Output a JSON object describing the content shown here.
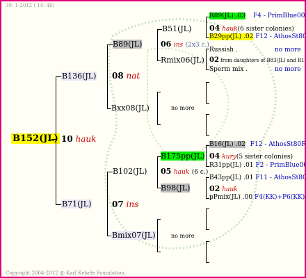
{
  "header_text": "30-  1-2012 ( 14: 46)",
  "footer_text": "Copyright 2004-2012 @ Karl Kehele Foundation.",
  "root": {
    "name": "B152(JL)",
    "num": "10",
    "note": "hauk"
  },
  "gen1": [
    {
      "name": "B136(JL)",
      "num": "08",
      "note": "nat"
    },
    {
      "name": "B71(JL)",
      "num": "07",
      "note": "ins"
    }
  ],
  "gen2": [
    {
      "name": "B89(JL)",
      "num": "06",
      "note": "ins",
      "extra": "(2x3 c.)"
    },
    {
      "name": "Bxx08(JL)"
    },
    {
      "name": "B102(JL)",
      "num": "05",
      "note": "hauk",
      "extra": "(6 c.)"
    },
    {
      "name": "Bmix07(JL)"
    }
  ],
  "gen3": [
    {
      "name": "B51(JL)",
      "num": "04",
      "note": "ins",
      "extra": "(2x3 c.)"
    },
    {
      "name": "Rmix06(JL)"
    },
    {
      "name": "no more"
    },
    {
      "name": "B175pp(JL)",
      "num": "04",
      "note": "kury",
      "extra": "(5 sister colonies)"
    },
    {
      "name": "B98(JL)",
      "num": "02",
      "note": "hauk"
    },
    {
      "name": "no more"
    }
  ],
  "gen4": [
    {
      "name": "R89(JL) .03",
      "info": "F4 - PrimBlue00"
    },
    {
      "num": "04",
      "note": "hauk",
      "extra": "(6 sister colonies)"
    },
    {
      "name": "B29pp(JL) .02",
      "info": "F12 - AthosSt80R"
    },
    {
      "name": "Russish .",
      "info": "no more"
    },
    {
      "num": "02",
      "extra": "from daughters of B83(JL) and R1"
    },
    {
      "name": "Sperm mix .",
      "info": "no more"
    },
    {
      "name": "B16(JL) .02",
      "info": "F12 - AthosSt80R"
    },
    {
      "name": "R31pp(JL) .01",
      "info": "F2 - PrimBlue00"
    },
    {
      "name": "B43pp(JL) .01",
      "info": "F11 - AthosSt80R"
    },
    {
      "name": "pPmix(JL) .00",
      "info": "F4(KK)+P6(KK)"
    }
  ],
  "colors": {
    "border": "#e0007a",
    "yellow": "#ffff00",
    "green": "#00ee00",
    "gray": "#bdbdbd",
    "red": "#cc0000",
    "blue": "#0000bb"
  }
}
